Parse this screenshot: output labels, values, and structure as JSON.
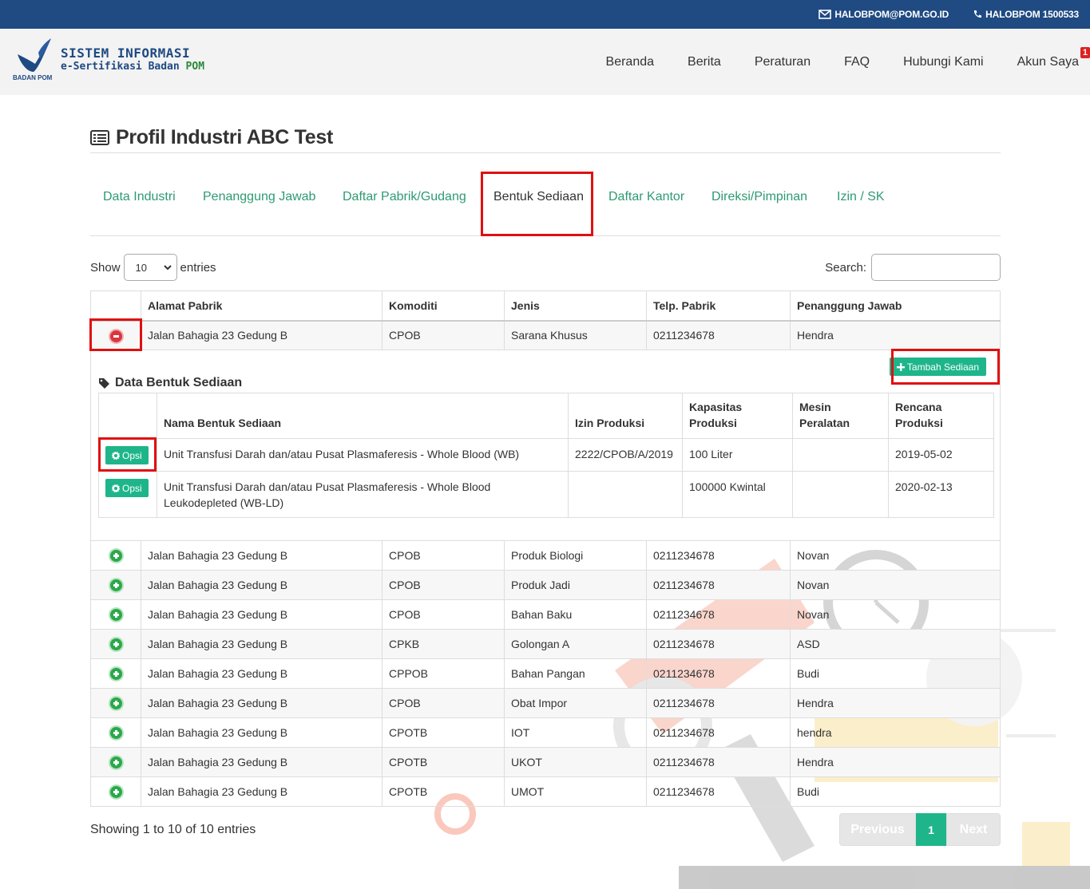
{
  "topbar": {
    "email": "HALOBPOM@POM.GO.ID",
    "phone": "HALOBPOM 1500533"
  },
  "brand": {
    "line1": "SISTEM INFORMASI",
    "line2_a": "e-Sertifikasi Badan",
    "line2_b": "POM",
    "sub": "BADAN POM"
  },
  "nav": {
    "items": [
      "Beranda",
      "Berita",
      "Peraturan",
      "FAQ",
      "Hubungi Kami",
      "Akun Saya"
    ],
    "badge": "1"
  },
  "page": {
    "title": "Profil Industri ABC Test"
  },
  "tabs": [
    "Data Industri",
    "Penanggung Jawab",
    "Daftar Pabrik/Gudang",
    "Bentuk Sediaan",
    "Daftar Kantor",
    "Direksi/Pimpinan",
    "Izin / SK"
  ],
  "controls": {
    "show": "Show",
    "entries_value": "10",
    "entries": "entries",
    "search": "Search:"
  },
  "table": {
    "columns": [
      "Alamat Pabrik",
      "Komoditi",
      "Jenis",
      "Telp. Pabrik",
      "Penanggung Jawab"
    ],
    "rows": [
      {
        "alamat": "Jalan Bahagia 23 Gedung B",
        "komoditi": "CPOB",
        "jenis": "Sarana Khusus",
        "telp": "0211234678",
        "pj": "Hendra"
      },
      {
        "alamat": "Jalan Bahagia 23 Gedung B",
        "komoditi": "CPOB",
        "jenis": "Produk Biologi",
        "telp": "0211234678",
        "pj": "Novan"
      },
      {
        "alamat": "Jalan Bahagia 23 Gedung B",
        "komoditi": "CPOB",
        "jenis": "Produk Jadi",
        "telp": "0211234678",
        "pj": "Novan"
      },
      {
        "alamat": "Jalan Bahagia 23 Gedung B",
        "komoditi": "CPOB",
        "jenis": "Bahan Baku",
        "telp": "0211234678",
        "pj": "Novan"
      },
      {
        "alamat": "Jalan Bahagia 23 Gedung B",
        "komoditi": "CPKB",
        "jenis": "Golongan A",
        "telp": "0211234678",
        "pj": "ASD"
      },
      {
        "alamat": "Jalan Bahagia 23 Gedung B",
        "komoditi": "CPPOB",
        "jenis": "Bahan Pangan",
        "telp": "0211234678",
        "pj": "Budi"
      },
      {
        "alamat": "Jalan Bahagia 23 Gedung B",
        "komoditi": "CPOB",
        "jenis": "Obat Impor",
        "telp": "0211234678",
        "pj": "Hendra"
      },
      {
        "alamat": "Jalan Bahagia 23 Gedung B",
        "komoditi": "CPOTB",
        "jenis": "IOT",
        "telp": "0211234678",
        "pj": "hendra"
      },
      {
        "alamat": "Jalan Bahagia 23 Gedung B",
        "komoditi": "CPOTB",
        "jenis": "UKOT",
        "telp": "0211234678",
        "pj": "Hendra"
      },
      {
        "alamat": "Jalan Bahagia 23 Gedung B",
        "komoditi": "CPOTB",
        "jenis": "UMOT",
        "telp": "0211234678",
        "pj": "Budi"
      }
    ]
  },
  "child": {
    "title": "Data Bentuk Sediaan",
    "add_button": "Tambah Sediaan",
    "columns": [
      "Nama Bentuk Sediaan",
      "Izin Produksi",
      "Kapasitas Produksi",
      "Mesin Peralatan",
      "Rencana Produksi"
    ],
    "opsi_label": "Opsi",
    "rows": [
      {
        "nama": "Unit Transfusi Darah dan/atau Pusat Plasmaferesis - Whole Blood (WB)",
        "izin": "2222/CPOB/A/2019",
        "kapasitas": "100 Liter",
        "mesin": "",
        "rencana": "2019-05-02"
      },
      {
        "nama": "Unit Transfusi Darah dan/atau Pusat Plasmaferesis - Whole Blood Leukodepleted (WB-LD)",
        "izin": "",
        "kapasitas": "100000 Kwintal",
        "mesin": "",
        "rencana": "2020-02-13"
      }
    ]
  },
  "footer": {
    "info": "Showing 1 to 10 of 10 entries",
    "prev": "Previous",
    "page": "1",
    "next": "Next"
  },
  "colors": {
    "topbar": "#1f4a82",
    "accent_green": "#1fb58a",
    "tab_link": "#2e9a72",
    "highlight_red": "#e01010"
  }
}
